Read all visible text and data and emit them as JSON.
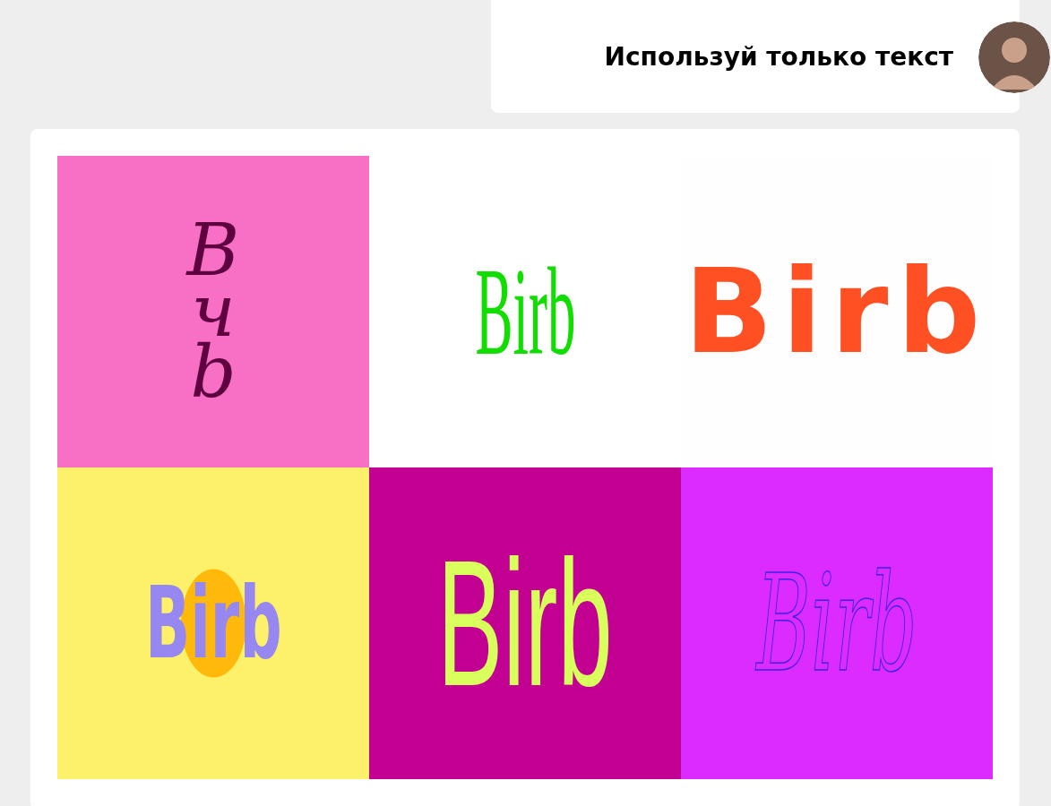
{
  "message": {
    "text": "Используй только текст"
  },
  "result": {
    "tiles": [
      {
        "kind": "script-stacked",
        "text": "Bчb",
        "color": "#f870c6"
      },
      {
        "kind": "condensed-serif",
        "text": "Birb",
        "color": "#ffffff"
      },
      {
        "kind": "heavy-split",
        "text": "Birb",
        "color": "#fefefe"
      },
      {
        "kind": "overlay",
        "text": "Birb",
        "color": "#fdf06a"
      },
      {
        "kind": "condensed-sans",
        "text": "Birb",
        "color": "#c20091"
      },
      {
        "kind": "outline-script",
        "text": "Birb",
        "color": "#dc2bff"
      }
    ]
  }
}
